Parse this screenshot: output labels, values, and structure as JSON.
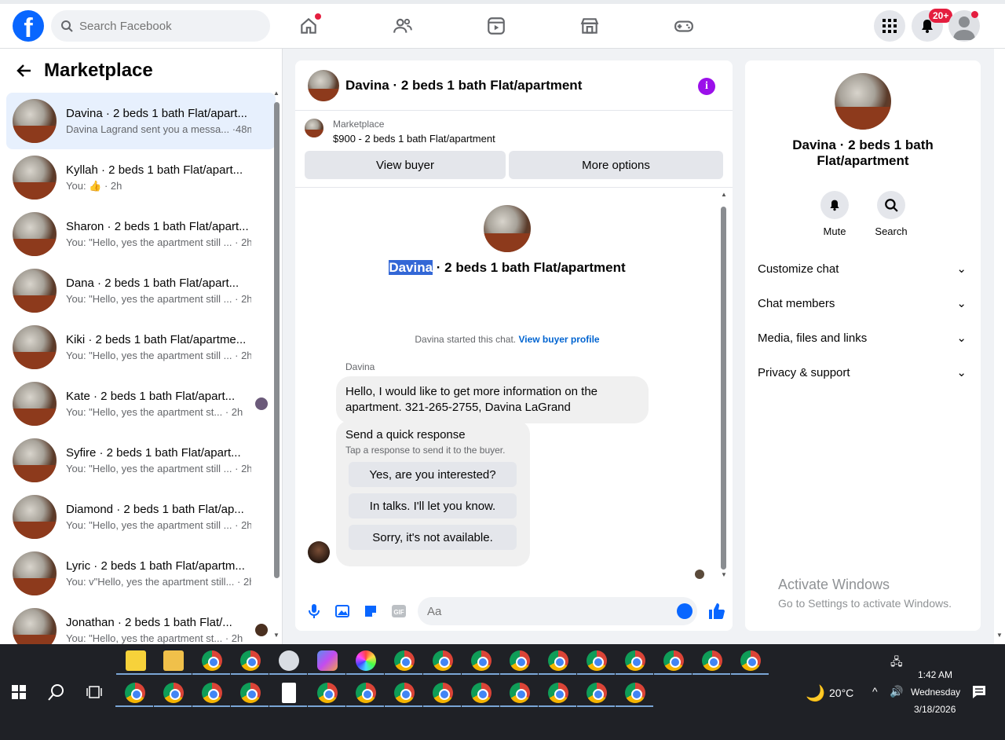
{
  "header": {
    "search_placeholder": "Search Facebook",
    "notifications_badge": "20+"
  },
  "sidebar": {
    "title": "Marketplace",
    "conversations": [
      {
        "title": "Davina · 2 beds 1 bath Flat/apart...",
        "subtitle": "Davina Lagrand sent you a messa... ·48m"
      },
      {
        "title": "Kyllah · 2 beds 1 bath Flat/apart...",
        "subtitle": "You: 👍 · 2h"
      },
      {
        "title": "Sharon · 2 beds 1 bath Flat/apart...",
        "subtitle": "You: \"Hello, yes the apartment still ... · 2h"
      },
      {
        "title": "Dana · 2 beds 1 bath Flat/apart...",
        "subtitle": "You: \"Hello, yes the apartment still ... · 2h"
      },
      {
        "title": "Kiki · 2 beds 1 bath Flat/apartme...",
        "subtitle": "You: \"Hello, yes the apartment still ... · 2h"
      },
      {
        "title": "Kate · 2 beds 1 bath Flat/apart...",
        "subtitle": "You: \"Hello, yes the apartment st... · 2h"
      },
      {
        "title": "Syfire · 2 beds 1 bath Flat/apart...",
        "subtitle": "You: \"Hello, yes the apartment still ... · 2h"
      },
      {
        "title": "Diamond · 2 beds 1 bath Flat/ap...",
        "subtitle": "You: \"Hello, yes the apartment still ... · 2h"
      },
      {
        "title": "Lyric · 2 beds 1 bath Flat/apartm...",
        "subtitle": "You: v\"Hello, yes the apartment still... · 2h"
      },
      {
        "title": "Jonathan · 2 beds 1 bath Flat/...",
        "subtitle": "You: \"Hello, yes the apartment st... · 2h"
      }
    ]
  },
  "chat": {
    "title": "Davina · 2 beds 1 bath Flat/apartment",
    "marketplace_label": "Marketplace",
    "listing": "$900 - 2 beds 1 bath Flat/apartment",
    "view_buyer": "View buyer",
    "more_options": "More options",
    "hero_name": "Davina",
    "hero_rest": " · 2 beds 1 bath Flat/apartment",
    "started_text": "Davina started this chat.",
    "buyer_profile_link": "View buyer profile",
    "sender": "Davina",
    "message": "Hello, I would like to get more information on the apartment.  321-265-2755, Davina LaGrand",
    "quick_title": "Send a quick response",
    "quick_sub": "Tap a response to send it to the buyer.",
    "quick_replies": [
      "Yes, are you interested?",
      "In talks. I'll let you know.",
      "Sorry, it's not available."
    ],
    "composer_placeholder": "Aa"
  },
  "details": {
    "title": "Davina · 2 beds 1 bath Flat/apartment",
    "mute": "Mute",
    "search": "Search",
    "sections": [
      "Customize chat",
      "Chat members",
      "Media, files and links",
      "Privacy & support"
    ]
  },
  "watermark": {
    "line1": "Activate Windows",
    "line2": "Go to Settings to activate Windows."
  },
  "taskbar": {
    "weather": "20°C",
    "time": "1:42 AM",
    "day": "Wednesday",
    "date": "3/18/2026"
  }
}
